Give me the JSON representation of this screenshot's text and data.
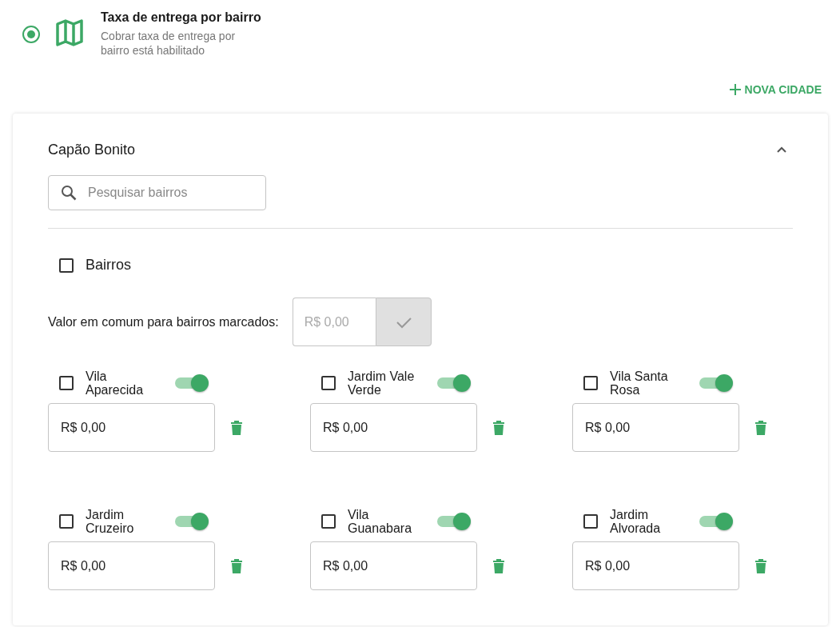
{
  "option": {
    "selected": true,
    "title": "Taxa de entrega por bairro",
    "description": "Cobrar taxa de entrega por bairro está habilitado"
  },
  "add_city_button": {
    "label": "NOVA CIDADE"
  },
  "city": {
    "name": "Capão Bonito",
    "expanded": true,
    "search": {
      "placeholder": "Pesquisar bairros"
    },
    "select_all": {
      "label": "Bairros",
      "checked": false
    },
    "common_value": {
      "label": "Valor em comum para bairros marcados:",
      "placeholder": "R$ 0,00"
    },
    "neighborhoods": [
      {
        "name": "Vila Aparecida",
        "checked": false,
        "on": true,
        "value": "R$ 0,00"
      },
      {
        "name": "Jardim Vale Verde",
        "checked": false,
        "on": true,
        "value": "R$ 0,00"
      },
      {
        "name": "Vila Santa Rosa",
        "checked": false,
        "on": true,
        "value": "R$ 0,00"
      },
      {
        "name": "Jardim Cruzeiro",
        "checked": false,
        "on": true,
        "value": "R$ 0,00"
      },
      {
        "name": "Vila Guanabara",
        "checked": false,
        "on": true,
        "value": "R$ 0,00"
      },
      {
        "name": "Jardim Alvorada",
        "checked": false,
        "on": true,
        "value": "R$ 0,00"
      }
    ]
  }
}
